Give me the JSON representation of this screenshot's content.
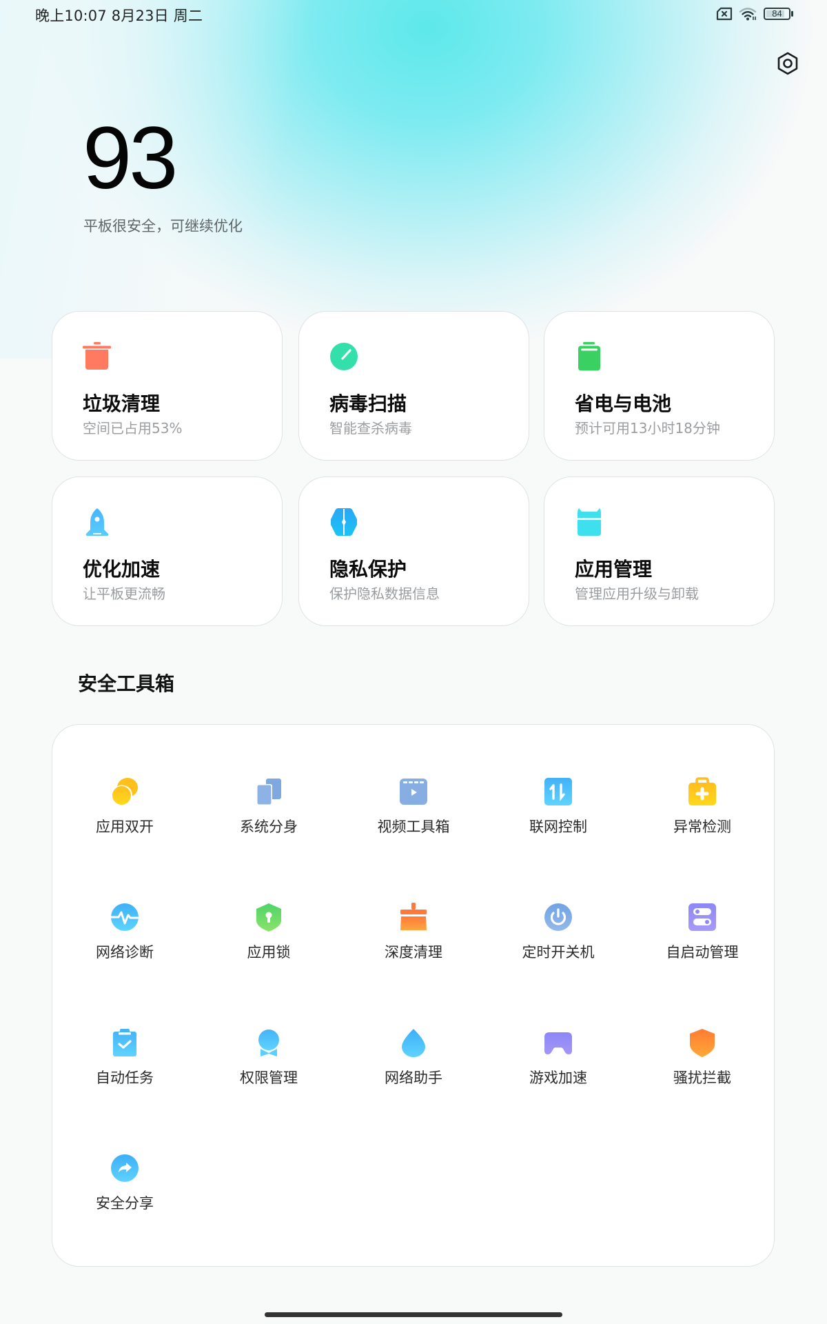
{
  "status_bar": {
    "time": "晚上10:07  8月23日 周二",
    "battery_level": "84",
    "battery_percent": 84,
    "icons": [
      "sim-missing-icon",
      "wifi-icon",
      "battery-icon"
    ]
  },
  "header": {
    "settings_icon": "settings-hexagon-icon",
    "score": "93",
    "status_text": "平板很安全，可继续优化"
  },
  "cards": [
    {
      "id": "cleaner",
      "icon": "trash-can-icon",
      "color": "#ff7a61",
      "title": "垃圾清理",
      "subtitle": "空间已占用53%"
    },
    {
      "id": "virus",
      "icon": "virus-scan-icon",
      "color": "#33dfab",
      "title": "病毒扫描",
      "subtitle": "智能查杀病毒"
    },
    {
      "id": "battery",
      "icon": "battery-icon",
      "color": "#3ad062",
      "title": "省电与电池",
      "subtitle": "预计可用13小时18分钟"
    },
    {
      "id": "boost",
      "icon": "rocket-icon",
      "color": "#4cbcff",
      "title": "优化加速",
      "subtitle": "让平板更流畅"
    },
    {
      "id": "privacy",
      "icon": "privacy-shield-icon",
      "color": "#1db5f5",
      "title": "隐私保护",
      "subtitle": "保护隐私数据信息"
    },
    {
      "id": "apps",
      "icon": "android-app-icon",
      "color": "#3ee0ee",
      "title": "应用管理",
      "subtitle": "管理应用升级与卸载"
    }
  ],
  "toolbox": {
    "title": "安全工具箱",
    "tools": [
      {
        "icon": "dual-apps-icon",
        "label": "应用双开"
      },
      {
        "icon": "second-space-icon",
        "label": "系统分身"
      },
      {
        "icon": "video-toolbox-icon",
        "label": "视频工具箱"
      },
      {
        "icon": "data-usage-icon",
        "label": "联网控制"
      },
      {
        "icon": "first-aid-kit-icon",
        "label": "异常检测"
      },
      {
        "icon": "network-diagnostics-icon",
        "label": "网络诊断"
      },
      {
        "icon": "app-lock-icon",
        "label": "应用锁"
      },
      {
        "icon": "deep-clean-brush-icon",
        "label": "深度清理"
      },
      {
        "icon": "power-schedule-icon",
        "label": "定时开关机"
      },
      {
        "icon": "autostart-toggle-icon",
        "label": "自启动管理"
      },
      {
        "icon": "clipboard-check-icon",
        "label": "自动任务"
      },
      {
        "icon": "permissions-icon",
        "label": "权限管理"
      },
      {
        "icon": "water-drop-icon",
        "label": "网络助手"
      },
      {
        "icon": "gamepad-icon",
        "label": "游戏加速"
      },
      {
        "icon": "block-shield-icon",
        "label": "骚扰拦截"
      },
      {
        "icon": "share-arrow-icon",
        "label": "安全分享"
      }
    ]
  }
}
